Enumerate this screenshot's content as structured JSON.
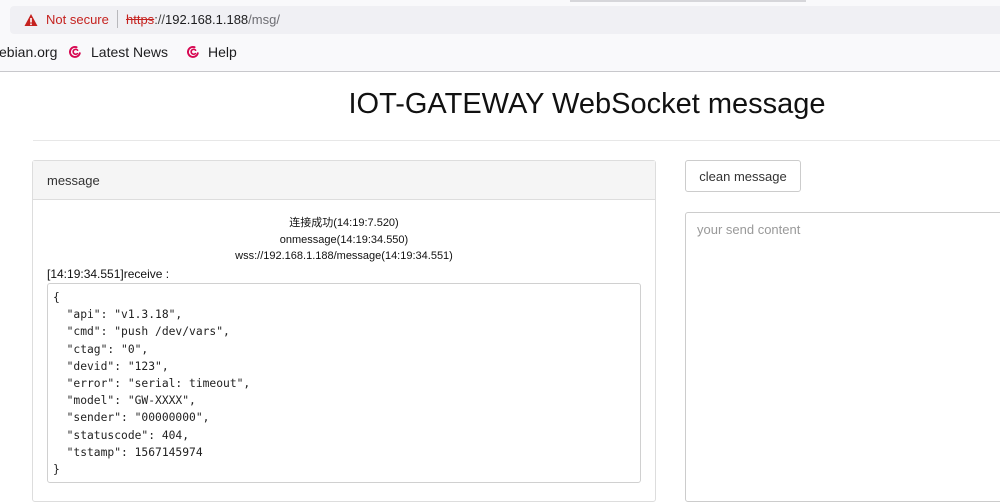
{
  "browser": {
    "security_label": "Not secure",
    "url_scheme": "https",
    "url_sep": "://",
    "url_host": "192.168.1.188",
    "url_path": "/msg/",
    "bookmarks": [
      {
        "label": "ebian.org"
      },
      {
        "label": "Latest News",
        "icon": "debian-swirl-icon"
      },
      {
        "label": "Help",
        "icon": "debian-swirl-icon"
      }
    ],
    "colors": {
      "warning": "#c5221f",
      "debian": "#d70751"
    }
  },
  "page": {
    "title": "IOT-GATEWAY WebSocket message"
  },
  "message_panel": {
    "heading": "message",
    "status_lines": [
      "连接成功(14:19:7.520)",
      "onmessage(14:19:34.550)",
      "wss://192.168.1.188/message(14:19:34.551)"
    ],
    "receive_label": "[14:19:34.551]receive :",
    "json_text": "{\n  \"api\": \"v1.3.18\",\n  \"cmd\": \"push /dev/vars\",\n  \"ctag\": \"0\",\n  \"devid\": \"123\",\n  \"error\": \"serial: timeout\",\n  \"model\": \"GW-XXXX\",\n  \"sender\": \"00000000\",\n  \"statuscode\": 404,\n  \"tstamp\": 1567145974\n}"
  },
  "controls": {
    "clean_label": "clean message",
    "send_placeholder": "your send content",
    "send_value": ""
  }
}
